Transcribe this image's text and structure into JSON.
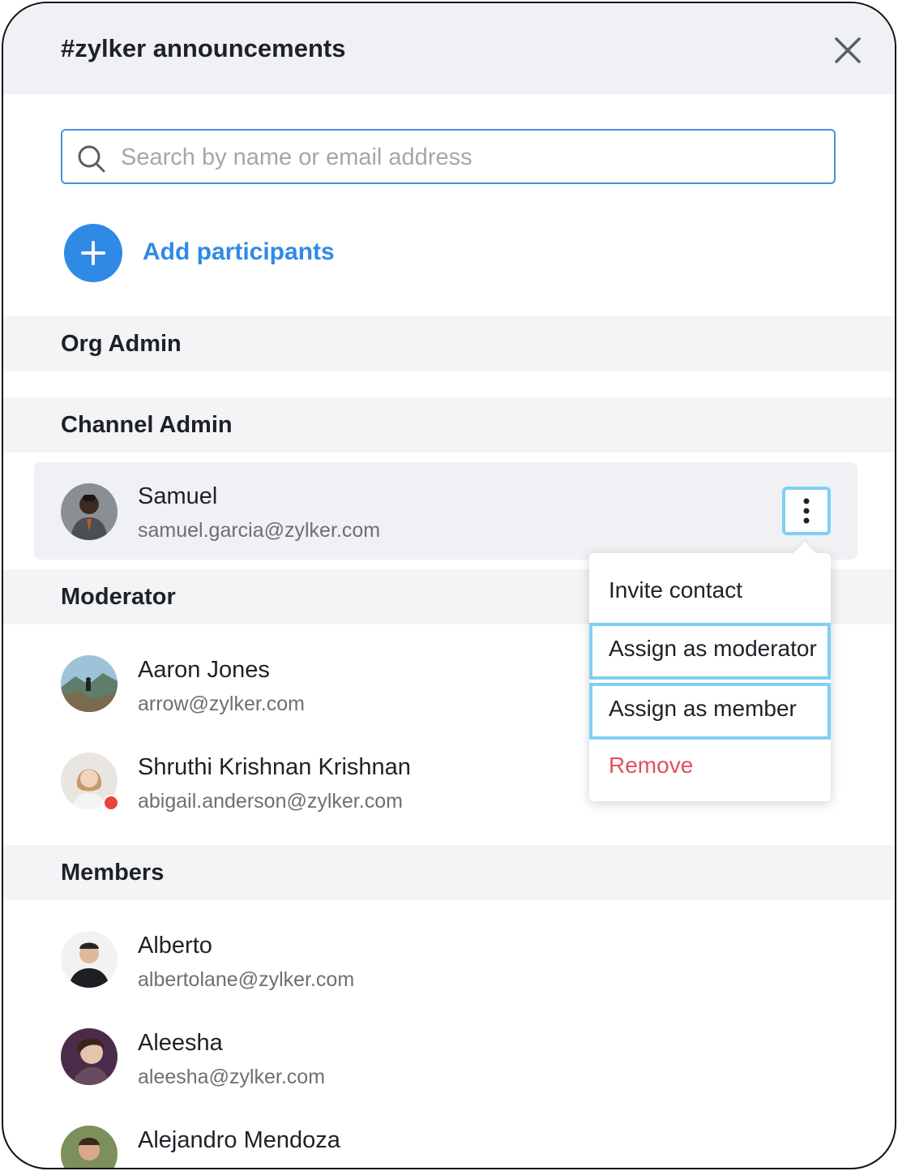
{
  "header": {
    "title": "#zylker announcements",
    "close_icon": "close-icon"
  },
  "search": {
    "placeholder": "Search by name or email address",
    "value": ""
  },
  "add_participants": {
    "label": "Add participants",
    "icon": "plus-icon",
    "color": "#2f8ae6"
  },
  "sections": {
    "org_admin": {
      "title": "Org Admin"
    },
    "channel_admin": {
      "title": "Channel Admin"
    },
    "moderator": {
      "title": "Moderator"
    },
    "members": {
      "title": "Members"
    }
  },
  "channel_admins": [
    {
      "name": "Samuel",
      "email": "samuel.garcia@zylker.com"
    }
  ],
  "moderators": [
    {
      "name": "Aaron Jones",
      "email": "arrow@zylker.com"
    },
    {
      "name": "Shruthi Krishnan Krishnan",
      "email": "abigail.anderson@zylker.com",
      "status": "busy"
    }
  ],
  "members": [
    {
      "name": "Alberto",
      "email": "albertolane@zylker.com"
    },
    {
      "name": "Aleesha",
      "email": "aleesha@zylker.com"
    },
    {
      "name": "Alejandro Mendoza",
      "email": ""
    }
  ],
  "context_menu": {
    "items": [
      {
        "label": "Invite contact"
      },
      {
        "label": "Assign as moderator"
      },
      {
        "label": "Assign as member"
      },
      {
        "label": "Remove",
        "color": "#e0525e"
      }
    ]
  },
  "colors": {
    "accent": "#2f8ae6",
    "highlight_border": "#7fd0f4",
    "status_busy": "#e8453c"
  }
}
